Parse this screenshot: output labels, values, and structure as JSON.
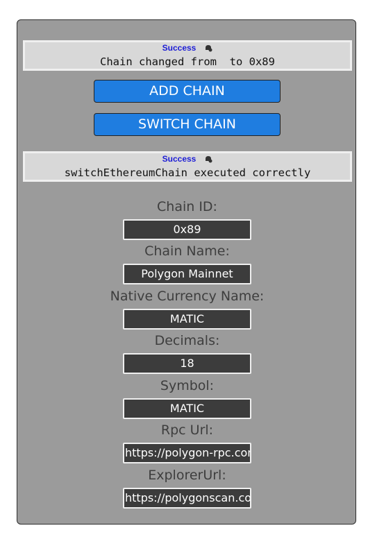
{
  "notifications": [
    {
      "title": "Success",
      "icon": "bell-icon",
      "message": "Chain changed from  to 0x89"
    },
    {
      "title": "Success",
      "icon": "bell-icon",
      "message": "switchEthereumChain executed correctly"
    }
  ],
  "buttons": {
    "add_chain": "ADD CHAIN",
    "switch_chain": "SWITCH CHAIN"
  },
  "fields": {
    "chain_id": {
      "label": "Chain ID:",
      "value": "0x89"
    },
    "chain_name": {
      "label": "Chain Name:",
      "value": "Polygon Mainnet"
    },
    "currency_name": {
      "label": "Native Currency Name:",
      "value": "MATIC"
    },
    "decimals": {
      "label": "Decimals:",
      "value": "18"
    },
    "symbol": {
      "label": "Symbol:",
      "value": "MATIC"
    },
    "rpc_url": {
      "label": "Rpc Url:",
      "value": "https://polygon-rpc.com"
    },
    "explorer_url": {
      "label": "ExplorerUrl:",
      "value": "https://polygonscan.com"
    }
  },
  "colors": {
    "panel": "#9b9b9b",
    "button": "#1f7de0",
    "success_title": "#1c1cd6",
    "field_bg": "#3c3c3c"
  }
}
